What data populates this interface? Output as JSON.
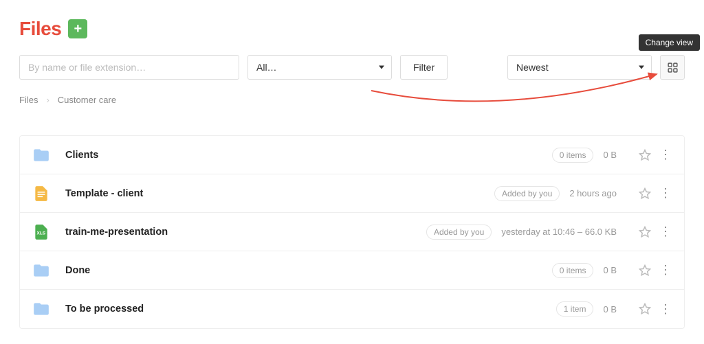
{
  "header": {
    "title": "Files"
  },
  "toolbar": {
    "search_placeholder": "By name or file extension…",
    "type_filter": "All…",
    "filter_label": "Filter",
    "sort": "Newest",
    "view_tooltip": "Change view"
  },
  "breadcrumb": {
    "root": "Files",
    "current": "Customer care"
  },
  "files": [
    {
      "name": "Clients",
      "icon": "folder",
      "badge": "0 items",
      "meta": "0 B"
    },
    {
      "name": "Template - client",
      "icon": "doc",
      "badge": "Added by you",
      "meta": "2 hours ago"
    },
    {
      "name": "train-me-presentation",
      "icon": "xls",
      "badge": "Added by you",
      "meta": "yesterday at 10:46 – 66.0 KB"
    },
    {
      "name": "Done",
      "icon": "folder",
      "badge": "0 items",
      "meta": "0 B"
    },
    {
      "name": "To be processed",
      "icon": "folder",
      "badge": "1 item",
      "meta": "0 B"
    }
  ],
  "icons": {
    "xls_label": "XLS"
  }
}
